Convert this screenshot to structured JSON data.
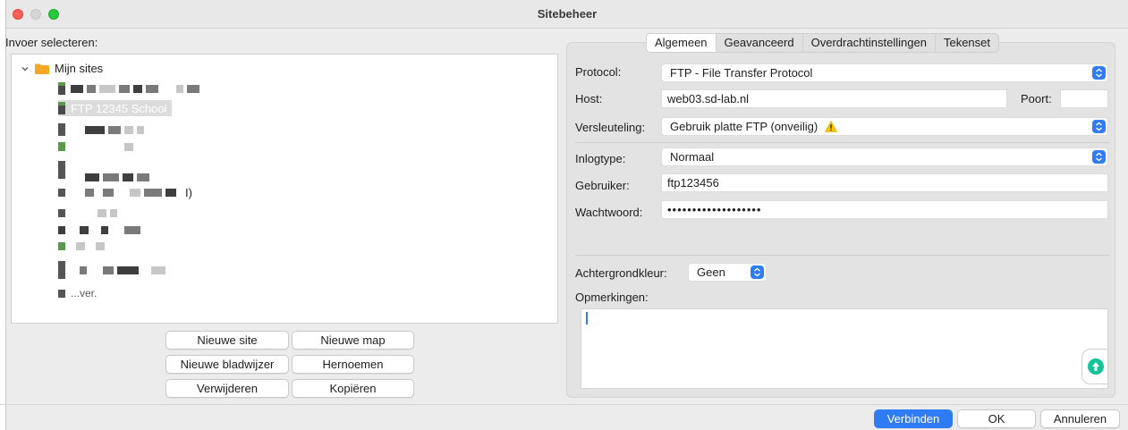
{
  "window": {
    "title": "Sitebeheer"
  },
  "left": {
    "label": "Invoer selecteren:",
    "root_label": "Mijn sites",
    "selected_site": "FTP 12345 School",
    "partial_text_1": "I)",
    "partial_text_2": "...ver."
  },
  "buttons": {
    "new_site": "Nieuwe site",
    "new_folder": "Nieuwe map",
    "new_bookmark": "Nieuwe bladwijzer",
    "rename": "Hernoemen",
    "delete": "Verwijderen",
    "copy": "Kopiëren"
  },
  "tabs": [
    "Algemeen",
    "Geavanceerd",
    "Overdrachtinstellingen",
    "Tekenset"
  ],
  "form": {
    "protocol_label": "Protocol:",
    "protocol_value": "FTP - File Transfer Protocol",
    "host_label": "Host:",
    "host_value": "web03.sd-lab.nl",
    "port_label": "Poort:",
    "port_value": "",
    "encryption_label": "Versleuteling:",
    "encryption_value": "Gebruik platte FTP (onveilig)",
    "logintype_label": "Inlogtype:",
    "logintype_value": "Normaal",
    "user_label": "Gebruiker:",
    "user_value": "ftp123456",
    "password_label": "Wachtwoord:",
    "password_value": "•••••••••••••••••••",
    "bgcolor_label": "Achtergrondkleur:",
    "bgcolor_value": "Geen",
    "comments_label": "Opmerkingen:"
  },
  "footer": {
    "connect": "Verbinden",
    "ok": "OK",
    "cancel": "Annuleren"
  },
  "colors": {
    "accent": "#2f7cf6",
    "warning": "#f5c400",
    "close": "#fe5f57",
    "maximize": "#28c840"
  }
}
